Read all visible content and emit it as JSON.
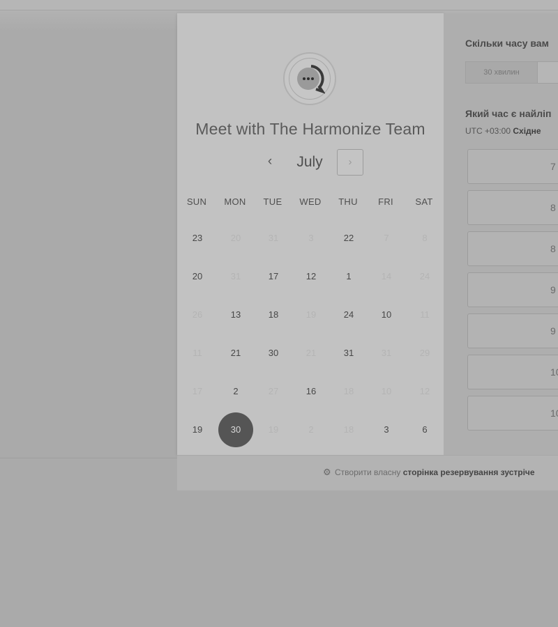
{
  "calendar": {
    "title": "Meet with The Harmonize Team",
    "month": "July",
    "prev_label": "‹",
    "next_label": "›",
    "weekdays": [
      "SUN",
      "MON",
      "TUE",
      "WED",
      "THU",
      "FRI",
      "SAT"
    ],
    "weeks": [
      [
        {
          "d": "23"
        },
        {
          "d": "20",
          "m": true
        },
        {
          "d": "31",
          "m": true
        },
        {
          "d": "3",
          "m": true
        },
        {
          "d": "22"
        },
        {
          "d": "7",
          "m": true
        },
        {
          "d": "8",
          "m": true
        }
      ],
      [
        {
          "d": "20"
        },
        {
          "d": "31",
          "m": true
        },
        {
          "d": "17"
        },
        {
          "d": "12"
        },
        {
          "d": "1"
        },
        {
          "d": "14",
          "m": true
        },
        {
          "d": "24",
          "m": true
        }
      ],
      [
        {
          "d": "26",
          "m": true
        },
        {
          "d": "13"
        },
        {
          "d": "18"
        },
        {
          "d": "19",
          "m": true
        },
        {
          "d": "24"
        },
        {
          "d": "10"
        },
        {
          "d": "11",
          "m": true
        }
      ],
      [
        {
          "d": "11",
          "m": true
        },
        {
          "d": "21"
        },
        {
          "d": "30"
        },
        {
          "d": "21",
          "m": true
        },
        {
          "d": "31"
        },
        {
          "d": "31",
          "m": true
        },
        {
          "d": "29",
          "m": true
        }
      ],
      [
        {
          "d": "17",
          "m": true
        },
        {
          "d": "2"
        },
        {
          "d": "27",
          "m": true
        },
        {
          "d": "16"
        },
        {
          "d": "18",
          "m": true
        },
        {
          "d": "10",
          "m": true
        },
        {
          "d": "12",
          "m": true
        }
      ],
      [
        {
          "d": "19"
        },
        {
          "d": "30",
          "s": true
        },
        {
          "d": "19",
          "m": true
        },
        {
          "d": "2",
          "m": true
        },
        {
          "d": "18",
          "m": true
        },
        {
          "d": "3"
        },
        {
          "d": "6"
        }
      ]
    ]
  },
  "scheduler": {
    "duration_question": "Скільки часу вам",
    "duration_option": "30 хвилин",
    "time_question": "Який час є найліп",
    "tz_prefix": "UTC +03:00 ",
    "tz_name": "Східне",
    "slots": [
      "7",
      "8",
      "8",
      "9",
      "9",
      "10",
      "10"
    ]
  },
  "footer": {
    "text_prefix": "Створити власну ",
    "text_bold": "сторінка резервування зустріче"
  }
}
